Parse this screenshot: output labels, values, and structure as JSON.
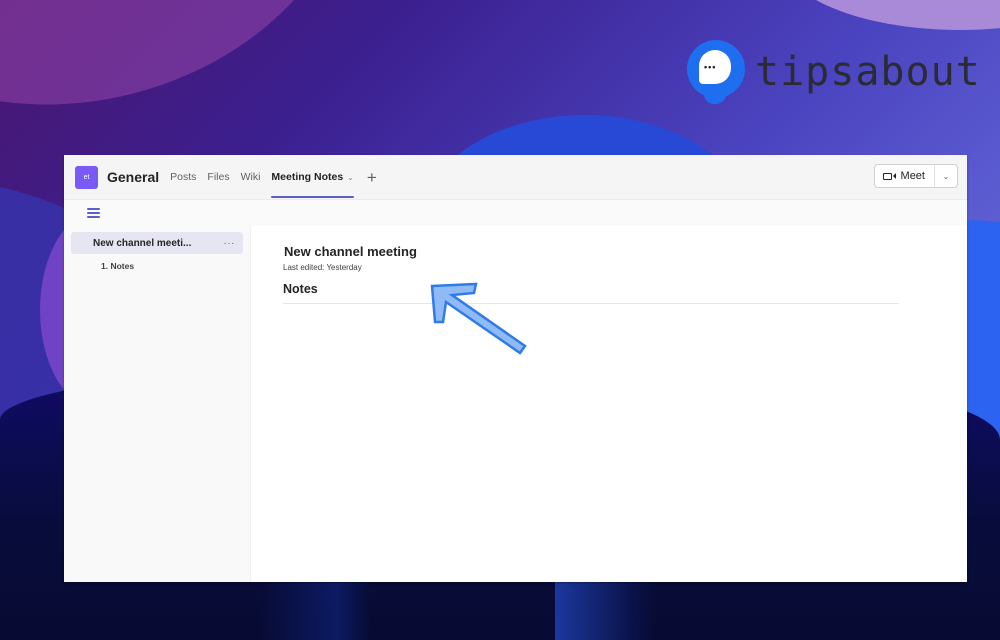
{
  "brand": {
    "logo_text": "tipsabout",
    "logo_glyph": "•••",
    "colors": {
      "logo_blue": "#1e6ef0",
      "accent": "#5b5fc7",
      "team_avatar": "#7a5af5",
      "arrow": "#6aa6f0"
    }
  },
  "header": {
    "team_avatar_text": "et",
    "channel_name": "General",
    "tabs": [
      {
        "label": "Posts",
        "active": false
      },
      {
        "label": "Files",
        "active": false
      },
      {
        "label": "Wiki",
        "active": false
      },
      {
        "label": "Meeting Notes",
        "active": true,
        "has_dropdown": true
      }
    ],
    "add_tab_icon": "+",
    "tab_dropdown_icon": "⌄",
    "meet_button": {
      "label": "Meet",
      "icon": "video-camera-icon",
      "dropdown_icon": "⌄"
    }
  },
  "toolbar": {
    "menu_icon": "hamburger-icon"
  },
  "sidebar": {
    "items": [
      {
        "label": "New channel meeti...",
        "more_icon": "···",
        "selected": true
      }
    ],
    "sub_items": [
      {
        "label": "1. Notes"
      }
    ]
  },
  "content": {
    "title": "New channel meeting",
    "last_edited": "Last edited: Yesterday",
    "section_heading": "Notes"
  },
  "annotation": {
    "type": "arrow",
    "pointing": "up-left",
    "target": "page title"
  }
}
